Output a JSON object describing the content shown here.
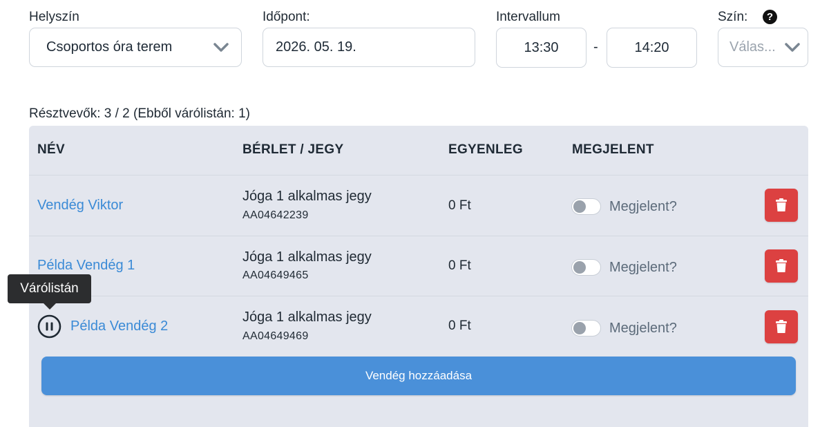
{
  "form": {
    "location_label": "Helyszín",
    "location_value": "Csoportos óra terem",
    "time_label": "Időpont:",
    "date_value": "2026. 05. 19.",
    "interval_label": "Intervallum",
    "start_time": "13:30",
    "separator": "-",
    "end_time": "14:20",
    "color_label": "Szín:",
    "color_placeholder": "Válas...",
    "help_icon_text": "?"
  },
  "participants": {
    "summary": "Résztvevők: 3 / 2 (Ebből várólistán: 1)",
    "headers": {
      "name": "NÉV",
      "pass": "BÉRLET / JEGY",
      "balance": "EGYENLEG",
      "attended": "MEGJELENT"
    },
    "rows": [
      {
        "name": "Vendég Viktor",
        "ticket": "Jóga 1 alkalmas jegy",
        "code": "AA04642239",
        "balance": "0 Ft",
        "attended_label": "Megjelent?",
        "attended": false,
        "waitlist": false
      },
      {
        "name": "Példa Vendég 1",
        "ticket": "Jóga 1 alkalmas jegy",
        "code": "AA04649465",
        "balance": "0 Ft",
        "attended_label": "Megjelent?",
        "attended": false,
        "waitlist": false
      },
      {
        "name": "Példa Vendég 2",
        "ticket": "Jóga 1 alkalmas jegy",
        "code": "AA04649469",
        "balance": "0 Ft",
        "attended_label": "Megjelent?",
        "attended": false,
        "waitlist": true
      }
    ],
    "waitlist_tooltip": "Várólistán",
    "add_button": "Vendég hozzáadása"
  },
  "colors": {
    "link": "#3a8ad6",
    "delete": "#dc4141",
    "primary": "#4a90d9",
    "panel": "#e3e6ee"
  },
  "icons": {
    "dropdown": "chevron-down-icon",
    "help": "question-circle-icon",
    "delete": "trash-icon",
    "waitlist": "pause-circle-icon"
  }
}
